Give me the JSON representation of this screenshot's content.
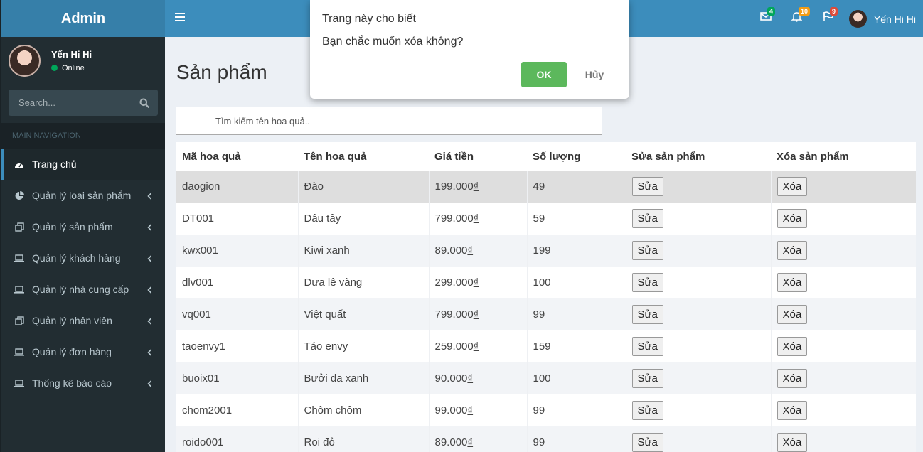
{
  "sidebar": {
    "logo": "Admin",
    "user": {
      "name": "Yến Hi Hi",
      "status": "Online"
    },
    "search": {
      "placeholder": "Search..."
    },
    "nav_header": "MAIN NAVIGATION",
    "items": [
      {
        "label": "Trang chủ",
        "icon": "dashboard-icon"
      },
      {
        "label": "Quản lý loại sản phẩm",
        "icon": "pie-chart-icon"
      },
      {
        "label": "Quản lý sản phẩm",
        "icon": "copy-icon"
      },
      {
        "label": "Quản lý khách hàng",
        "icon": "laptop-icon"
      },
      {
        "label": "Quản lý nhà cung cấp",
        "icon": "laptop-icon"
      },
      {
        "label": "Quản lý nhân viên",
        "icon": "copy-icon"
      },
      {
        "label": "Quản lý đơn hàng",
        "icon": "laptop-icon"
      },
      {
        "label": "Thống kê báo cáo",
        "icon": "laptop-icon"
      }
    ]
  },
  "header": {
    "badges": {
      "messages": "4",
      "notifications": "10",
      "flags": "9"
    },
    "badge_colors": {
      "messages": "#00a65a",
      "notifications": "#f39c12",
      "flags": "#dd4b39"
    },
    "user_name": "Yến Hi Hi"
  },
  "main": {
    "title": "Sản phẩm",
    "search_placeholder": "Tìm kiếm tên hoa quả..",
    "columns": [
      "Mã hoa quả",
      "Tên hoa quả",
      "Giá tiền",
      "Số lượng",
      "Sửa sản phẩm",
      "Xóa sản phẩm"
    ],
    "currency": "₫",
    "edit_label": "Sửa",
    "delete_label": "Xóa",
    "rows": [
      {
        "code": "daogion",
        "name": "Đào",
        "price": "199.000",
        "qty": "49"
      },
      {
        "code": "DT001",
        "name": "Dâu tây",
        "price": "799.000",
        "qty": "59"
      },
      {
        "code": "kwx001",
        "name": "Kiwi xanh",
        "price": "89.000",
        "qty": "199"
      },
      {
        "code": "dlv001",
        "name": "Dưa lê vàng",
        "price": "299.000",
        "qty": "100"
      },
      {
        "code": "vq001",
        "name": "Việt quất",
        "price": "799.000",
        "qty": "99"
      },
      {
        "code": "taoenvy1",
        "name": "Táo envy",
        "price": "259.000",
        "qty": "159"
      },
      {
        "code": "buoix01",
        "name": "Bưởi da xanh",
        "price": "90.000",
        "qty": "100"
      },
      {
        "code": "chom2001",
        "name": "Chôm chôm",
        "price": "99.000",
        "qty": "99"
      },
      {
        "code": "roido001",
        "name": "Roi đỏ",
        "price": "89.000",
        "qty": "99"
      }
    ]
  },
  "dialog": {
    "title": "Trang này cho biết",
    "message": "Bạn chắc muốn xóa không?",
    "ok": "OK",
    "cancel": "Hủy"
  }
}
